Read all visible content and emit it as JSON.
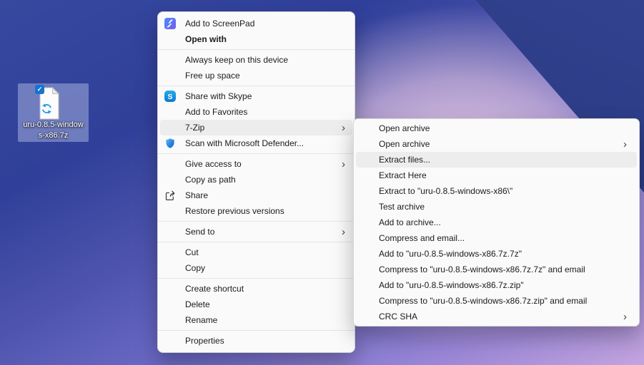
{
  "desktop": {
    "file": {
      "name_line1": "uru-0.8.5-window",
      "name_line2": "s-x86.7z",
      "full_name": "uru-0.8.5-windows-x86.7z"
    }
  },
  "glyphs": {
    "chevron": "›",
    "check": "✓",
    "skype_initial": "S"
  },
  "colors": {
    "menu_background": "#fafafa",
    "menu_highlight": "#ededed",
    "menu_text": "#1b1b1b",
    "separator": "#e5e5e5",
    "wallpaper_blue": "#36489f",
    "wallpaper_navy": "#1d2d72",
    "wallpaper_lilac": "#c2a4de",
    "wallpaper_pink_glow": "#f3d4e9",
    "skype_blue": "#0a86d8",
    "defender_blue": "#2e8ae6",
    "sync_blue": "#1e9ce4",
    "check_badge_blue": "#1673d1",
    "screenpad_blue": "#4f8df6",
    "screenpad_purple": "#7e57ee"
  },
  "menu": {
    "items": [
      {
        "label": "Add to ScreenPad",
        "icon": "screenpad-icon"
      },
      {
        "label": "Open with",
        "bold": true
      },
      {
        "label": "Always keep on this device"
      },
      {
        "label": "Free up space"
      },
      {
        "label": "Share with Skype",
        "icon": "skype-icon"
      },
      {
        "label": "Add to Favorites"
      },
      {
        "label": "7-Zip",
        "has_submenu": true,
        "highlighted": true
      },
      {
        "label": "Scan with Microsoft Defender...",
        "icon": "defender-shield-icon"
      },
      {
        "label": "Give access to",
        "has_submenu": true
      },
      {
        "label": "Copy as path"
      },
      {
        "label": "Share",
        "icon": "share-icon"
      },
      {
        "label": "Restore previous versions"
      },
      {
        "label": "Send to",
        "has_submenu": true
      },
      {
        "label": "Cut"
      },
      {
        "label": "Copy"
      },
      {
        "label": "Create shortcut"
      },
      {
        "label": "Delete"
      },
      {
        "label": "Rename"
      },
      {
        "label": "Properties"
      }
    ]
  },
  "submenu_7zip": {
    "items": [
      {
        "label": "Open archive"
      },
      {
        "label": "Open archive",
        "has_submenu": true
      },
      {
        "label": "Extract files...",
        "highlighted": true
      },
      {
        "label": "Extract Here"
      },
      {
        "label": "Extract to \"uru-0.8.5-windows-x86\\\""
      },
      {
        "label": "Test archive"
      },
      {
        "label": "Add to archive..."
      },
      {
        "label": "Compress and email..."
      },
      {
        "label": "Add to \"uru-0.8.5-windows-x86.7z.7z\""
      },
      {
        "label": "Compress to \"uru-0.8.5-windows-x86.7z.7z\" and email"
      },
      {
        "label": "Add to \"uru-0.8.5-windows-x86.7z.zip\""
      },
      {
        "label": "Compress to \"uru-0.8.5-windows-x86.7z.zip\" and email"
      },
      {
        "label": "CRC SHA",
        "has_submenu": true
      }
    ]
  }
}
